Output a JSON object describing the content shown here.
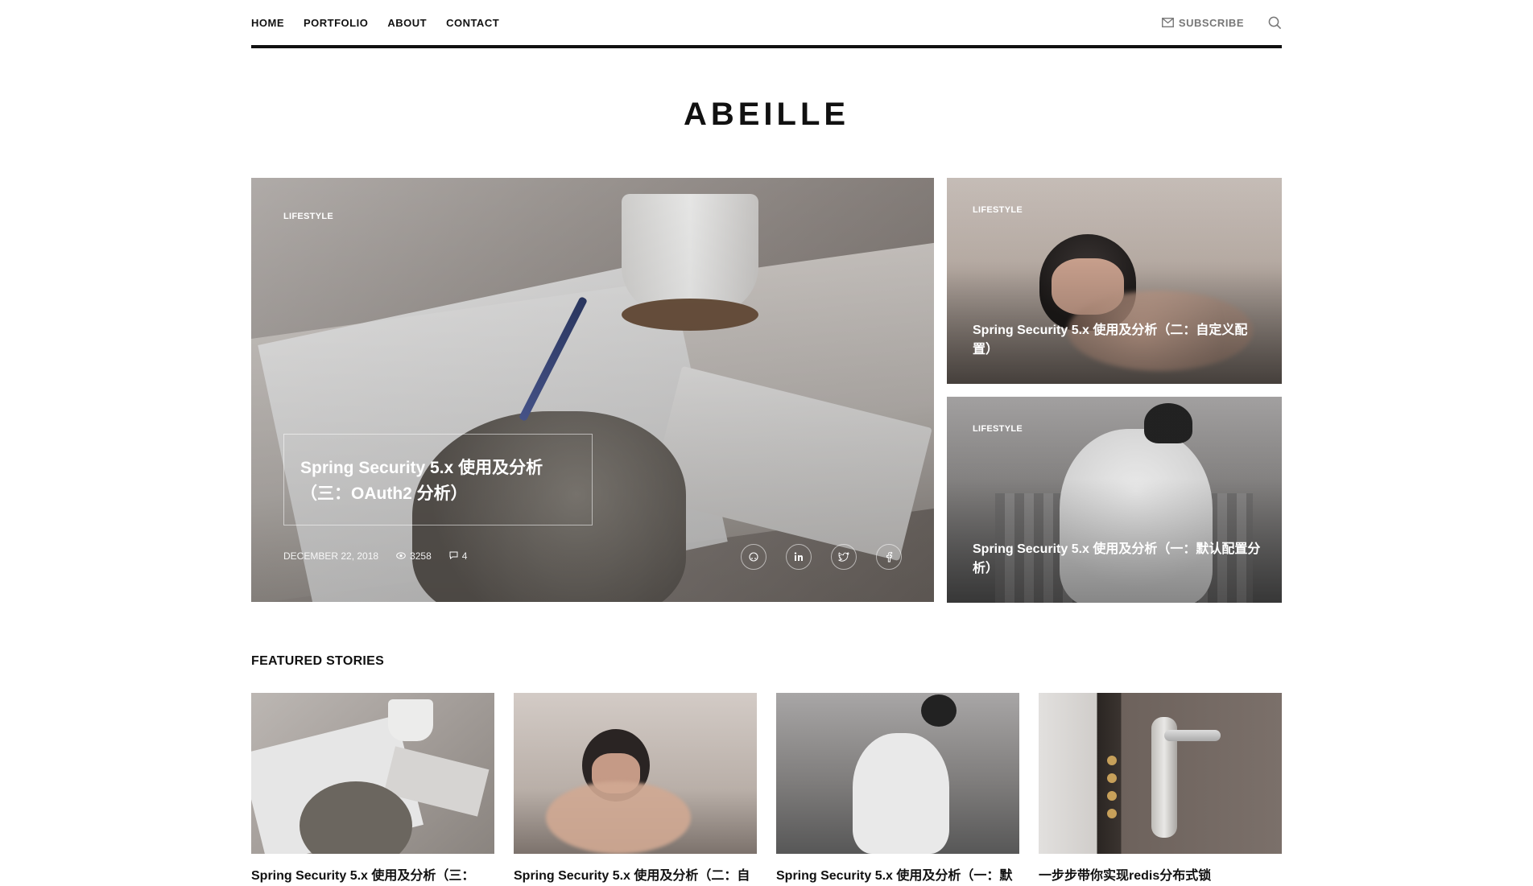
{
  "nav": {
    "items": [
      "HOME",
      "PORTFOLIO",
      "ABOUT",
      "CONTACT"
    ],
    "subscribe_label": "SUBSCRIBE",
    "subscribe_icon": "mail-icon",
    "search_icon": "search-icon"
  },
  "site": {
    "logo": "ABEILLE"
  },
  "hero": {
    "main": {
      "category": "LIFESTYLE",
      "title": "Spring Security 5.x 使用及分析（三：OAuth2 分析）",
      "date": "DECEMBER 22, 2018",
      "views": "3258",
      "comments": "4",
      "social": [
        "github-icon",
        "linkedin-icon",
        "twitter-icon",
        "facebook-icon"
      ]
    },
    "side": [
      {
        "category": "LIFESTYLE",
        "title": "Spring Security 5.x 使用及分析（二：自定义配置）"
      },
      {
        "category": "LIFESTYLE",
        "title": "Spring Security 5.x 使用及分析（一：默认配置分析）"
      }
    ]
  },
  "featured": {
    "heading": "FEATURED STORIES",
    "cards": [
      {
        "title": "Spring Security 5.x 使用及分析（三："
      },
      {
        "title": "Spring Security 5.x 使用及分析（二：自"
      },
      {
        "title": "Spring Security 5.x 使用及分析（一：默"
      },
      {
        "title": "一步步带你实现redis分布式锁"
      }
    ]
  }
}
